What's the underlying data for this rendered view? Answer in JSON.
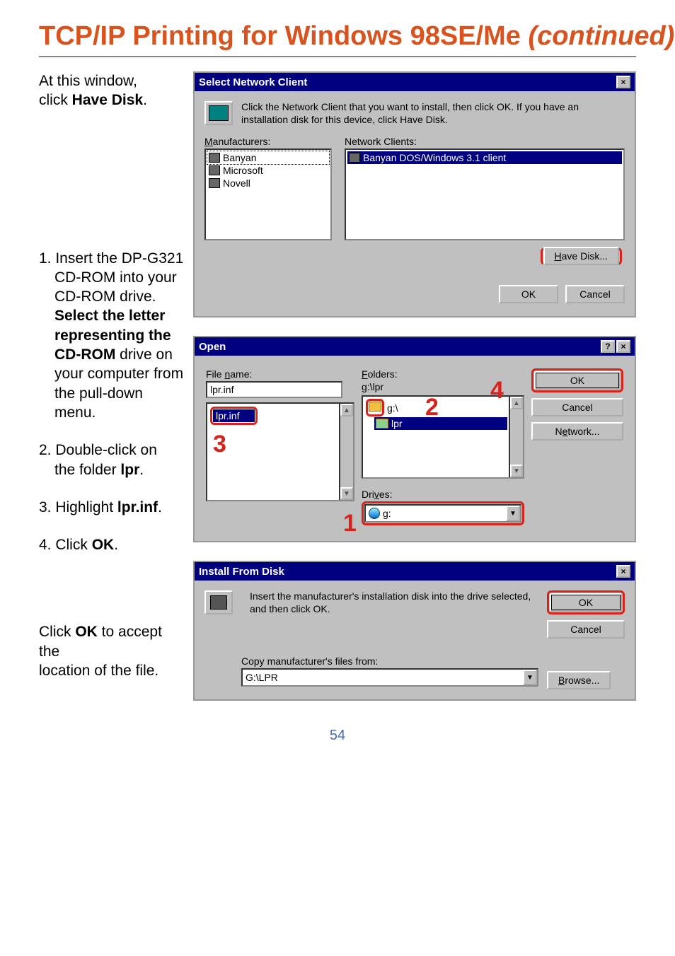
{
  "title_main": "TCP/IP Printing for Windows 98SE/Me ",
  "title_suffix": "(continued)",
  "page_number": "54",
  "intro_line1": "At this window,",
  "intro_line2_a": "click ",
  "intro_line2_b": "Have Disk",
  "intro_line2_c": ".",
  "steps": {
    "s1a": "1. Insert the DP-G321",
    "s1b": "CD-ROM into your",
    "s1c": "CD-ROM  drive.",
    "s1d": "Select the letter",
    "s1e": "representing the",
    "s1f": "CD-ROM",
    "s1g": " drive on",
    "s1h": "your computer from",
    "s1i": "the pull-down menu.",
    "s2a": "2. Double-click on",
    "s2b": "the folder ",
    "s2c": "lpr",
    "s2d": ".",
    "s3a": "3. Highlight ",
    "s3b": "lpr.inf",
    "s3c": ".",
    "s4a": "4.  Click ",
    "s4b": "OK",
    "s4c": "."
  },
  "below_a": "Click ",
  "below_b": "OK",
  "below_c": " to accept the",
  "below_d": "location of the file.",
  "dlg1": {
    "title": "Select Network Client",
    "close": "×",
    "hint": "Click the Network Client that you want to install, then click OK. If you have an installation disk for this device, click Have Disk.",
    "manuf_label_pre": "M",
    "manuf_label_rest": "anufacturers:",
    "clients_label": "Network Clients:",
    "manuf": [
      "Banyan",
      "Microsoft",
      "Novell"
    ],
    "client_item": "Banyan DOS/Windows 3.1 client",
    "have_disk_pre": "H",
    "have_disk_rest": "ave Disk...",
    "ok": "OK",
    "cancel": "Cancel"
  },
  "dlg2": {
    "title": "Open",
    "help": "?",
    "close": "×",
    "filename_label_pre": "File ",
    "filename_label_u": "n",
    "filename_label_post": "ame:",
    "filename_value": "lpr.inf",
    "file_list_item": "lpr.inf",
    "folders_label_u": "F",
    "folders_label_post": "olders:",
    "folders_path": "g:\\lpr",
    "folders_items": [
      "g:\\",
      "lpr"
    ],
    "drives_label_pre": "Dri",
    "drives_label_u": "v",
    "drives_label_post": "es:",
    "drive_value": "g:",
    "ok": "OK",
    "cancel": "Cancel",
    "network_pre": "N",
    "network_u": "e",
    "network_post": "twork..."
  },
  "dlg3": {
    "title": "Install From Disk",
    "close": "×",
    "hint": "Insert the manufacturer's installation disk into the drive selected, and then click OK.",
    "copy_label": "Copy manufacturer's files from:",
    "path_value": "G:\\LPR",
    "ok": "OK",
    "cancel": "Cancel",
    "browse_u": "B",
    "browse_rest": "rowse..."
  },
  "callouts": {
    "c1": "1",
    "c2": "2",
    "c3": "3",
    "c4": "4"
  }
}
